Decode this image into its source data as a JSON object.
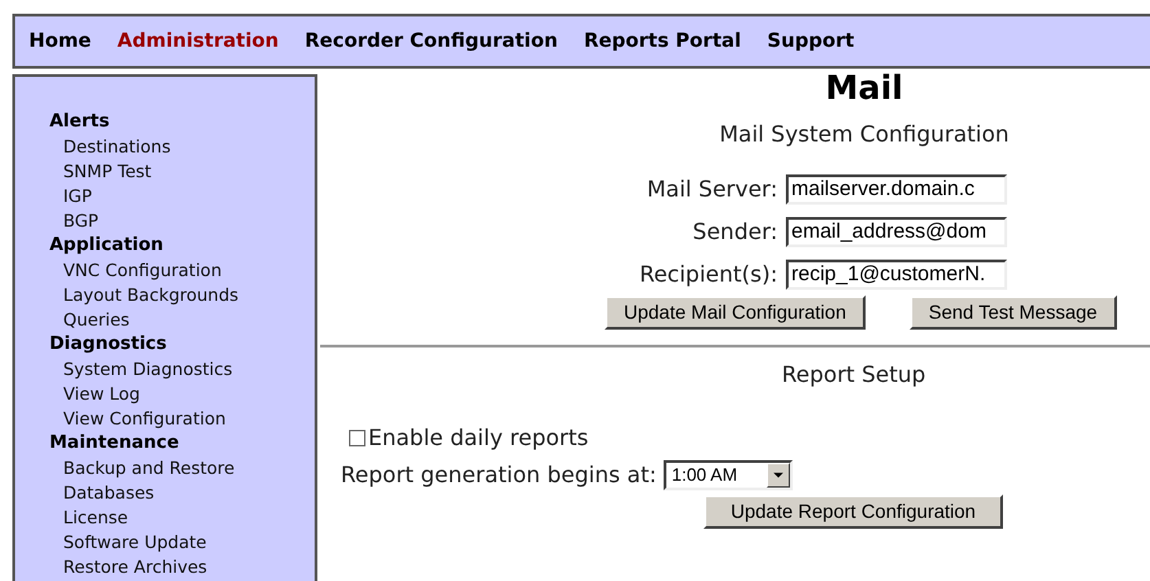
{
  "nav": [
    {
      "label": "Home",
      "selected": false
    },
    {
      "label": "Administration",
      "selected": true
    },
    {
      "label": "Recorder Configuration",
      "selected": false
    },
    {
      "label": "Reports Portal",
      "selected": false
    },
    {
      "label": "Support",
      "selected": false
    }
  ],
  "sidebar": [
    {
      "label": "Alerts",
      "children": [
        {
          "label": "Destinations"
        },
        {
          "label": "SNMP Test"
        },
        {
          "label": "IGP"
        },
        {
          "label": "BGP"
        }
      ]
    },
    {
      "label": "Application",
      "children": [
        {
          "label": "VNC Configuration"
        },
        {
          "label": "Layout Backgrounds"
        },
        {
          "label": "Queries"
        }
      ]
    },
    {
      "label": "Diagnostics",
      "children": [
        {
          "label": "System Diagnostics"
        },
        {
          "label": "View Log"
        },
        {
          "label": "View Configuration"
        }
      ]
    },
    {
      "label": "Maintenance",
      "children": [
        {
          "label": "Backup and Restore"
        },
        {
          "label": "Databases"
        },
        {
          "label": "License"
        },
        {
          "label": "Software Update"
        },
        {
          "label": "Restore Archives"
        }
      ]
    }
  ],
  "title": "Mail",
  "mail_section": {
    "heading": "Mail System Configuration",
    "fields": [
      {
        "label": "Mail Server:",
        "value": "mailserver.domain.c"
      },
      {
        "label": "Sender:",
        "value": "email_address@dom"
      },
      {
        "label": "Recipient(s):",
        "value": "recip_1@customerN."
      }
    ],
    "buttons": [
      "Update Mail Configuration",
      "Send Test Message"
    ]
  },
  "report_section": {
    "heading": "Report Setup",
    "enable_daily": {
      "label": "Enable daily reports",
      "checked": false
    },
    "start_time": {
      "label": "Report generation begins at:",
      "value": "1:00 AM"
    },
    "button": "Update Report Configuration"
  }
}
